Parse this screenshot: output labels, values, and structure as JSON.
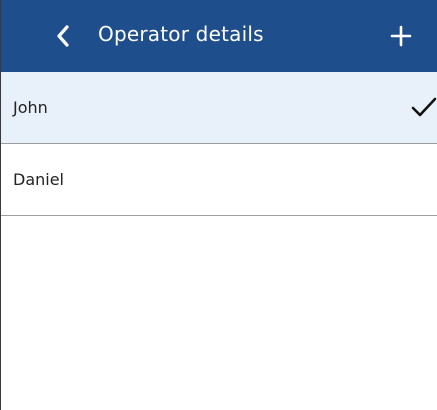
{
  "header": {
    "title": "Operator details",
    "back_icon": "chevron-left-icon",
    "add_icon": "plus-icon"
  },
  "operators": [
    {
      "name": "John",
      "selected": true
    },
    {
      "name": "Daniel",
      "selected": false
    }
  ],
  "colors": {
    "appbar": "#1f4e8c",
    "selected_row": "#e8f0fa",
    "divider": "#9e9e9e"
  }
}
